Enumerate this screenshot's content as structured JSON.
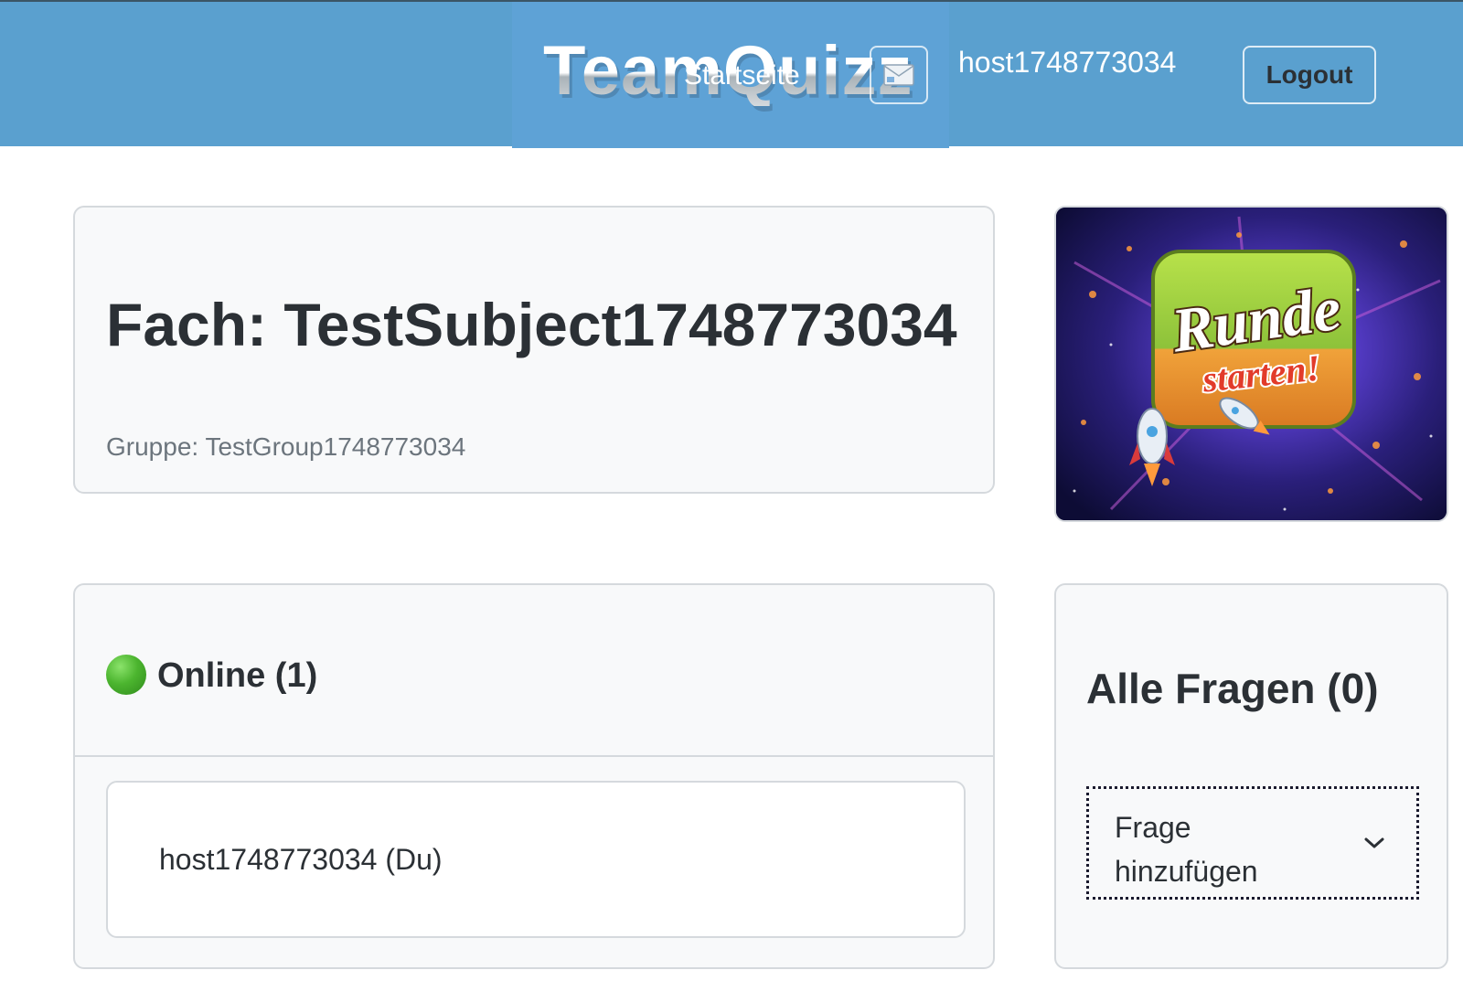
{
  "header": {
    "logo_text": "TeamQuizz",
    "home_link": "Startseite",
    "username": "host1748773034",
    "logout_label": "Logout",
    "icons": {
      "mail": "mail-icon"
    }
  },
  "subject_card": {
    "title": "Fach: TestSubject1748773034",
    "group": "Gruppe: TestGroup1748773034"
  },
  "start_round_image": {
    "line1": "Runde",
    "line2": "starten!"
  },
  "online_card": {
    "title": "Online (1)",
    "status_icon": "green-circle-icon",
    "users": [
      {
        "label": "host1748773034 (Du)"
      }
    ]
  },
  "questions_card": {
    "title": "Alle Fragen (0)",
    "add_select_label": "Frage hinzufügen",
    "icons": {
      "chevron": "chevron-down-icon"
    }
  },
  "colors": {
    "header_bg": "#5aa0cf",
    "card_bg": "#f8f9fa",
    "card_border": "#d5d9dd",
    "text": "#2b3035",
    "muted_text": "#6c757d",
    "online_green": "#4cb52f"
  }
}
